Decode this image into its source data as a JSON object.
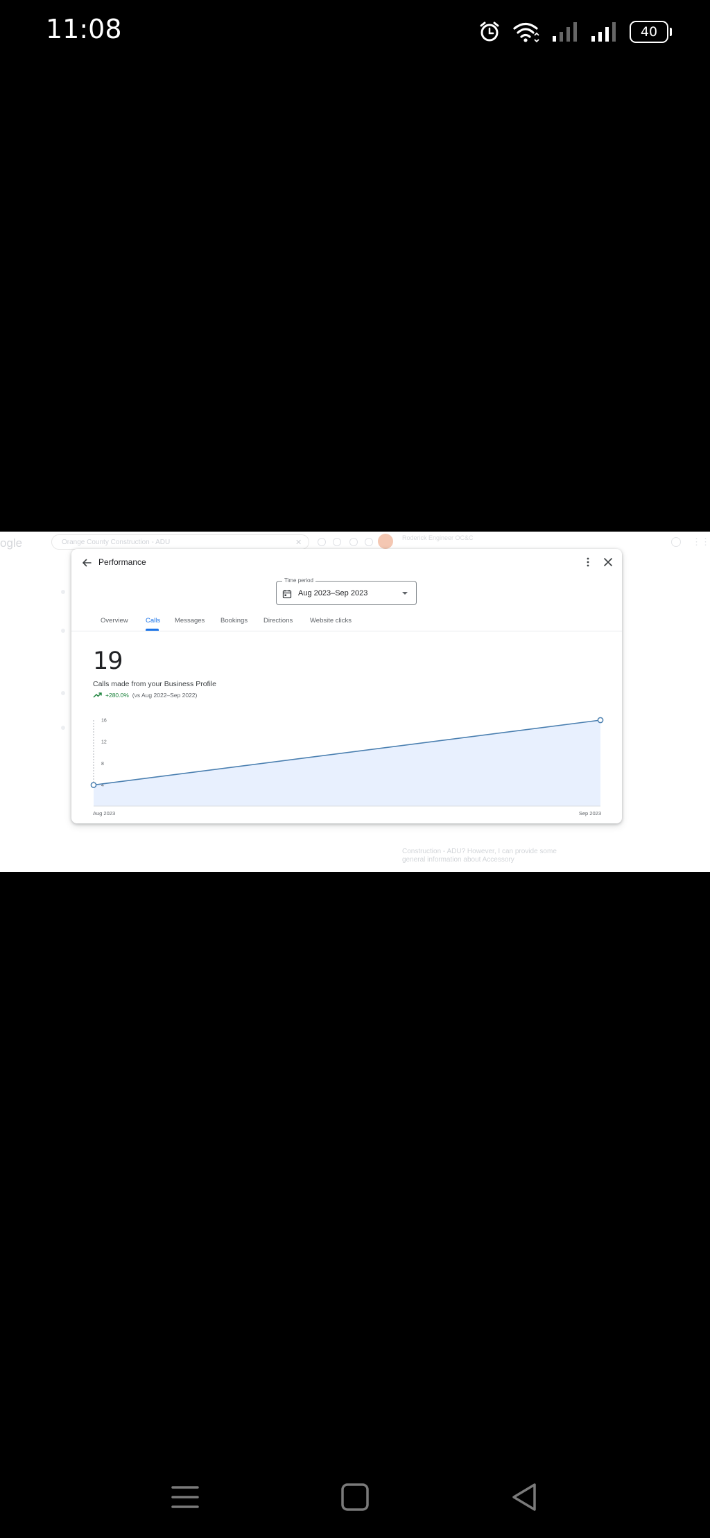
{
  "status_bar": {
    "time": "11:08",
    "battery": "40",
    "icons": [
      "alarm-icon",
      "wifi-icon",
      "signal-icon",
      "signal-icon"
    ]
  },
  "background_page": {
    "logo": "ogle",
    "search_text": "Orange County Construction - ADU",
    "side_title": "Roderick Engineer OC&C",
    "bottom_text": "Construction - ADU? However, I can provide some general information about Accessory"
  },
  "dialog": {
    "title": "Performance",
    "time_period": {
      "label": "Time period",
      "value": "Aug 2023–Sep 2023"
    },
    "tabs": [
      {
        "label": "Overview",
        "active": false
      },
      {
        "label": "Calls",
        "active": true
      },
      {
        "label": "Messages",
        "active": false
      },
      {
        "label": "Bookings",
        "active": false
      },
      {
        "label": "Directions",
        "active": false
      },
      {
        "label": "Website clicks",
        "active": false
      }
    ],
    "metric": {
      "value": "19",
      "caption": "Calls made from your Business Profile",
      "change": "+280.0%",
      "comparison": "(vs Aug 2022–Sep 2022)"
    }
  },
  "chart_data": {
    "type": "area",
    "x": [
      "Aug 2023",
      "Sep 2023"
    ],
    "series": [
      {
        "values": [
          4,
          16
        ]
      }
    ],
    "yticks": [
      4,
      8,
      12,
      16
    ],
    "ylim": [
      1,
      16
    ],
    "grid": false,
    "colors": {
      "line": "#4a7fb0",
      "fill": "#e8f0fe"
    }
  },
  "nav_bar": {
    "buttons": [
      "menu-icon",
      "home-icon",
      "back-icon"
    ]
  }
}
